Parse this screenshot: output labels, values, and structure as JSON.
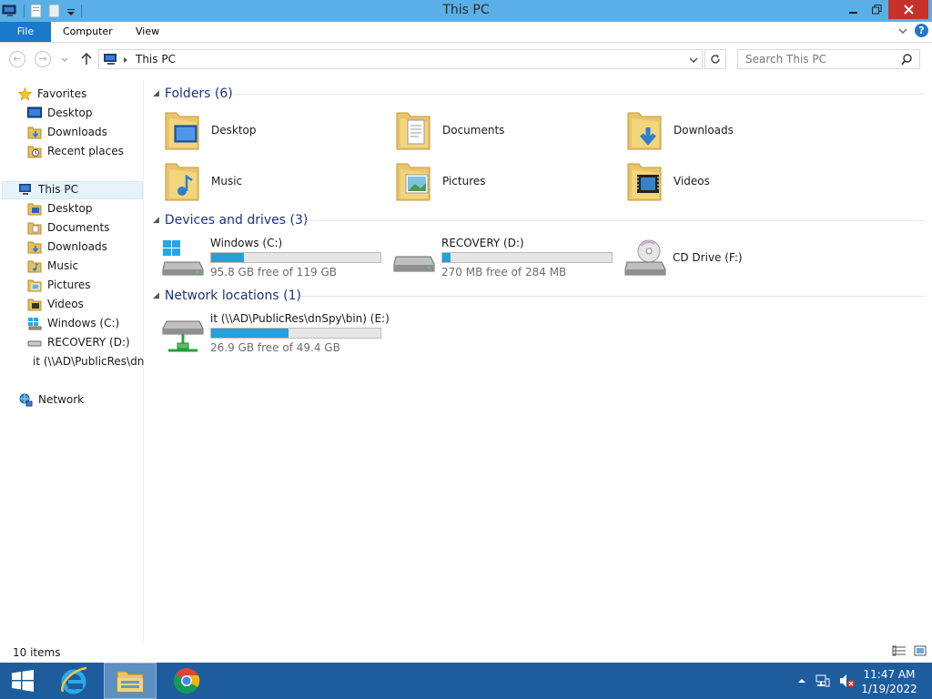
{
  "window": {
    "title": "This PC"
  },
  "ribbon": {
    "tabs": [
      "File",
      "Computer",
      "View"
    ]
  },
  "address": {
    "path": "This PC",
    "search_placeholder": "Search This PC"
  },
  "nav": {
    "favorites": {
      "label": "Favorites",
      "items": [
        "Desktop",
        "Downloads",
        "Recent places"
      ]
    },
    "this_pc": {
      "label": "This PC",
      "items": [
        "Desktop",
        "Documents",
        "Downloads",
        "Music",
        "Pictures",
        "Videos",
        "Windows (C:)",
        "RECOVERY (D:)",
        "it (\\\\AD\\PublicRes\\dnSpy\\bin) (E:)"
      ]
    },
    "network": {
      "label": "Network"
    }
  },
  "groups": {
    "folders": {
      "title": "Folders (6)",
      "items": [
        "Desktop",
        "Documents",
        "Downloads",
        "Music",
        "Pictures",
        "Videos"
      ]
    },
    "devices": {
      "title": "Devices and drives (3)",
      "drives": [
        {
          "name": "Windows (C:)",
          "free": "95.8 GB free of 119 GB",
          "used_fraction": 0.195
        },
        {
          "name": "RECOVERY (D:)",
          "free": "270 MB free of 284 MB",
          "used_fraction": 0.05
        },
        {
          "name": "CD Drive (F:)"
        }
      ]
    },
    "network": {
      "title": "Network locations (1)",
      "drives": [
        {
          "name": "it (\\\\AD\\PublicRes\\dnSpy\\bin) (E:)",
          "free": "26.9 GB free of 49.4 GB",
          "used_fraction": 0.455
        }
      ]
    }
  },
  "status": {
    "items": "10 items"
  },
  "taskbar": {
    "time": "11:47 AM",
    "date": "1/19/2022"
  },
  "colors": {
    "titlebar": "#5ab0e6",
    "accent": "#1979ca",
    "bar": "#26a0da",
    "taskbar": "#1d5d9e",
    "close": "#c7312b"
  }
}
